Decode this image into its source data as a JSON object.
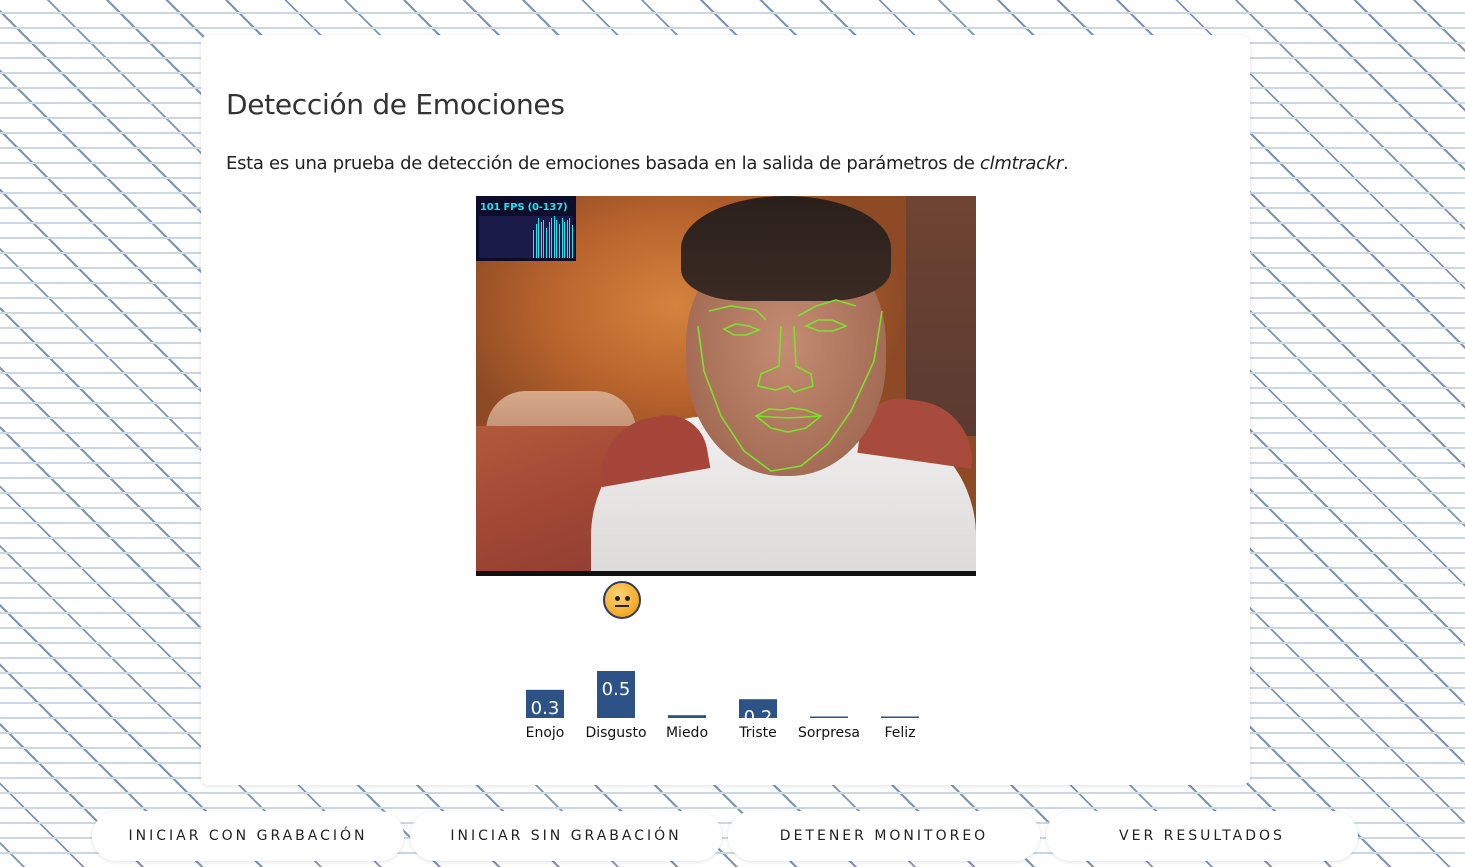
{
  "page": {
    "title": "Detección de Emociones",
    "description_prefix": "Esta es una prueba de detección de emociones basada en la salida de parámetros de ",
    "description_em": "clmtrackr",
    "description_suffix": "."
  },
  "video": {
    "fps_label": "101 FPS (0-137)"
  },
  "emotion_icon": "neutral-face-icon",
  "chart_data": {
    "type": "bar",
    "categories": [
      "Enojo",
      "Disgusto",
      "Miedo",
      "Triste",
      "Sorpresa",
      "Feliz"
    ],
    "values": [
      0.3,
      0.5,
      0.03,
      0.2,
      0.01,
      0.01
    ],
    "value_labels": [
      "0.3",
      "0.5",
      "",
      "0.2",
      "",
      ""
    ],
    "bar_color": "#2c5286",
    "ylim": [
      0,
      0.5
    ]
  },
  "buttons": [
    {
      "label": "INICIAR CON GRABACIÓN"
    },
    {
      "label": "INICIAR SIN GRABACIÓN"
    },
    {
      "label": "DETENER MONITOREO"
    },
    {
      "label": "VER RESULTADOS"
    }
  ]
}
